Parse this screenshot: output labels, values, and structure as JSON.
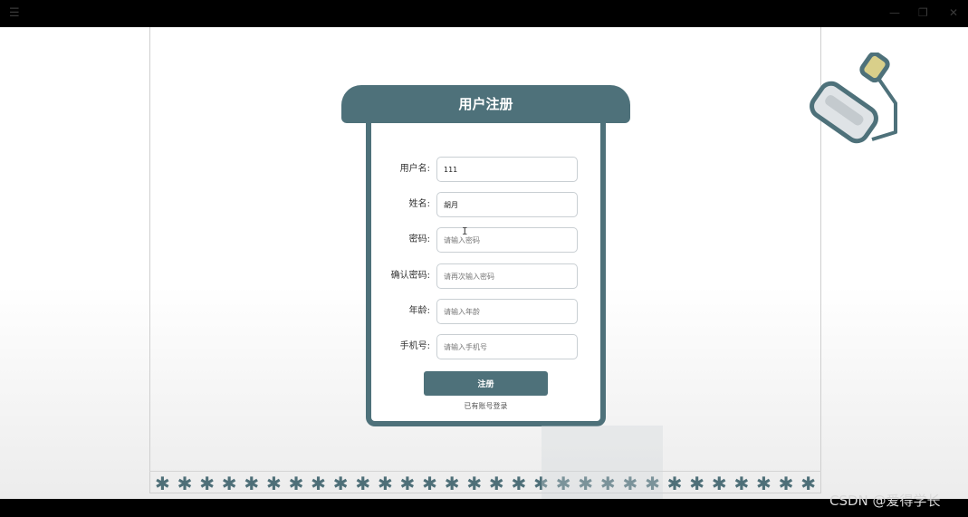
{
  "form": {
    "title": "用户注册",
    "fields": [
      {
        "label": "用户名:",
        "value": "111",
        "placeholder": ""
      },
      {
        "label": "姓名:",
        "value": "胡月",
        "placeholder": ""
      },
      {
        "label": "密码:",
        "value": "",
        "placeholder": "请输入密码"
      },
      {
        "label": "确认密码:",
        "value": "",
        "placeholder": "请再次输入密码"
      },
      {
        "label": "年龄:",
        "value": "",
        "placeholder": "请输入年龄"
      },
      {
        "label": "手机号:",
        "value": "",
        "placeholder": "请输入手机号"
      }
    ],
    "submit_label": "注册",
    "login_link": "已有账号登录"
  },
  "footer": {
    "star_glyph": "✱",
    "star_count": 30
  },
  "watermark": "CSDN @爱得学长",
  "colors": {
    "accent": "#4e717a",
    "input_border": "#c9cfd3"
  },
  "icons": {
    "menu": "menu-icon",
    "decoration": "paint-roller-icon"
  }
}
